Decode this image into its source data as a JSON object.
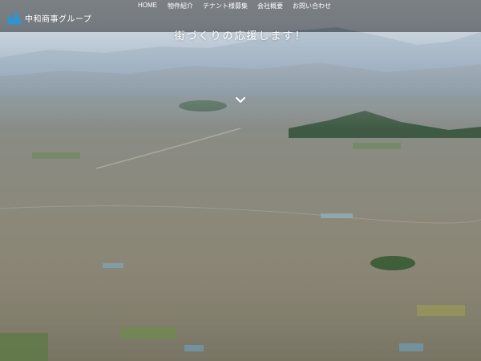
{
  "brand": {
    "name": "中和商事グループ",
    "logo_icon": "logo-triangle-icon",
    "accent_color": "#1e9be0"
  },
  "nav": {
    "items": [
      {
        "label": "HOME"
      },
      {
        "label": "物件紹介"
      },
      {
        "label": "テナント様募集"
      },
      {
        "label": "会社概要"
      },
      {
        "label": "お問い合わせ"
      }
    ]
  },
  "hero": {
    "tagline": "街づくりの応援します！",
    "scroll_icon": "chevron-down-icon"
  }
}
